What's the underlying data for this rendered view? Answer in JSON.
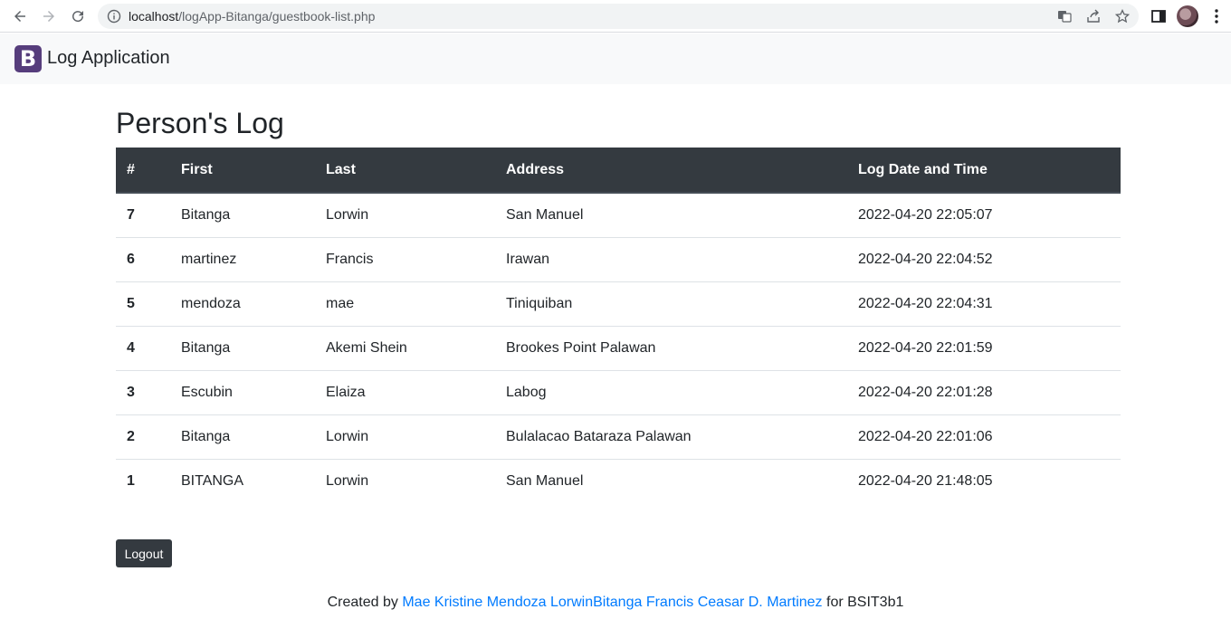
{
  "browser": {
    "url_host": "localhost",
    "url_path": "/logApp-Bitanga/guestbook-list.php"
  },
  "navbar": {
    "logo_letter": "B",
    "brand": "Log Application",
    "logo_color": "#563d7c"
  },
  "main": {
    "title": "Person's Log",
    "columns": [
      "#",
      "First",
      "Last",
      "Address",
      "Log Date and Time"
    ],
    "rows": [
      {
        "id": "7",
        "first": "Bitanga",
        "last": "Lorwin",
        "address": "San Manuel",
        "datetime": "2022-04-20 22:05:07"
      },
      {
        "id": "6",
        "first": "martinez",
        "last": "Francis",
        "address": "Irawan",
        "datetime": "2022-04-20 22:04:52"
      },
      {
        "id": "5",
        "first": "mendoza",
        "last": "mae",
        "address": "Tiniquiban",
        "datetime": "2022-04-20 22:04:31"
      },
      {
        "id": "4",
        "first": "Bitanga",
        "last": "Akemi Shein",
        "address": "Brookes Point Palawan",
        "datetime": "2022-04-20 22:01:59"
      },
      {
        "id": "3",
        "first": "Escubin",
        "last": "Elaiza",
        "address": "Labog",
        "datetime": "2022-04-20 22:01:28"
      },
      {
        "id": "2",
        "first": "Bitanga",
        "last": "Lorwin",
        "address": "Bulalacao Bataraza Palawan",
        "datetime": "2022-04-20 22:01:06"
      },
      {
        "id": "1",
        "first": "BITANGA",
        "last": "Lorwin",
        "address": "San Manuel",
        "datetime": "2022-04-20 21:48:05"
      }
    ],
    "logout_label": "Logout",
    "header_color": "#343a40"
  },
  "footer": {
    "prefix": "Created by",
    "authors": "Mae Kristine Mendoza LorwinBitanga Francis Ceasar D. Martinez",
    "suffix": "for BSIT3b1",
    "link_color": "#007bff"
  }
}
